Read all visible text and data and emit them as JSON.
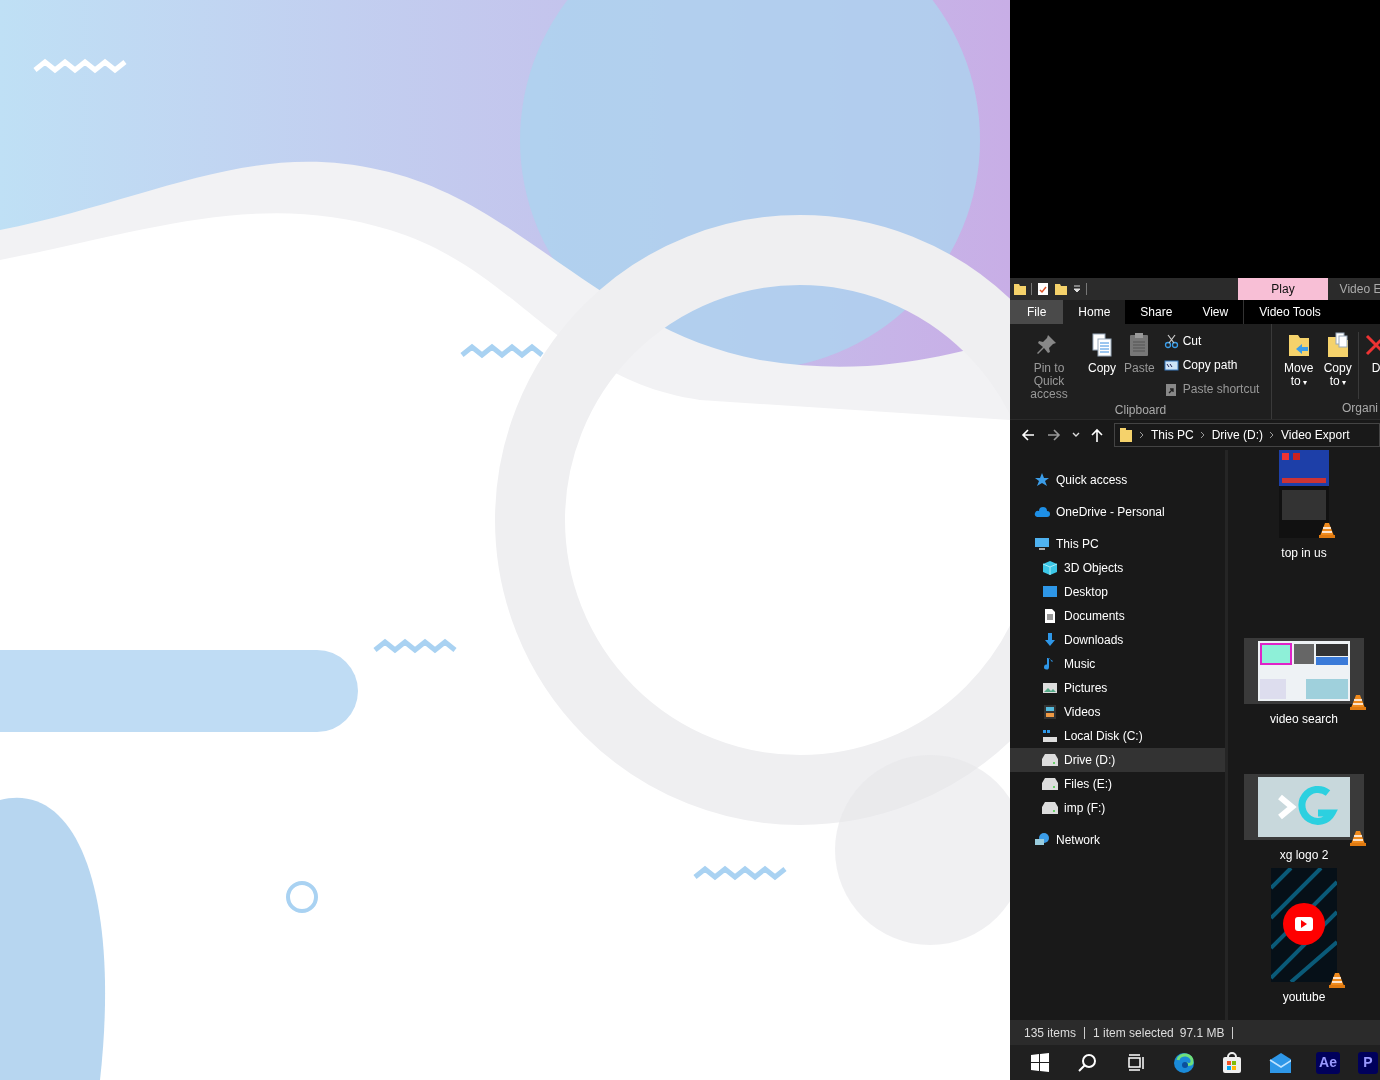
{
  "explorer": {
    "context_headers": [
      {
        "label": "Play",
        "highlighted": true
      },
      {
        "label": "Video E",
        "highlighted": false
      }
    ],
    "ribbon_tabs": [
      {
        "label": "File",
        "kind": "file",
        "selected": false
      },
      {
        "label": "Home",
        "kind": "tab",
        "selected": true
      },
      {
        "label": "Share",
        "kind": "tab",
        "selected": false
      },
      {
        "label": "View",
        "kind": "tab",
        "selected": false
      },
      {
        "label": "Video Tools",
        "kind": "tab",
        "selected": false
      }
    ],
    "ribbon_groups": [
      {
        "label": "Clipboard",
        "large_buttons": [
          {
            "label": "Pin to Quick access",
            "kind": "pin",
            "disabled": true
          },
          {
            "label": "Copy",
            "kind": "copy",
            "disabled": false
          },
          {
            "label": "Paste",
            "kind": "paste",
            "disabled": true
          }
        ],
        "small_buttons": [
          {
            "label": "Cut",
            "kind": "cut",
            "disabled": false
          },
          {
            "label": "Copy path",
            "kind": "path",
            "disabled": false
          },
          {
            "label": "Paste shortcut",
            "kind": "shortcut",
            "disabled": true
          }
        ]
      },
      {
        "label": "Organi",
        "large_buttons": [
          {
            "label": "Move to",
            "kind": "move",
            "disabled": false,
            "caret": "▾"
          },
          {
            "label": "Copy to",
            "kind": "copyto",
            "disabled": false,
            "caret": "▾"
          },
          {
            "label": "D",
            "kind": "delete",
            "disabled": false
          }
        ]
      }
    ],
    "address_crumbs": [
      "This PC",
      "Drive (D:)",
      "Video Export"
    ],
    "nav": [
      {
        "label": "Quick access",
        "kind": "star",
        "selected": false
      },
      {
        "label": "OneDrive - Personal",
        "kind": "cloud",
        "selected": false
      },
      {
        "label": "This PC",
        "kind": "pc",
        "selected": false,
        "children": [
          {
            "label": "3D Objects",
            "kind": "cube",
            "selected": false
          },
          {
            "label": "Desktop",
            "kind": "desktop",
            "selected": false
          },
          {
            "label": "Documents",
            "kind": "document",
            "selected": false
          },
          {
            "label": "Downloads",
            "kind": "download",
            "selected": false
          },
          {
            "label": "Music",
            "kind": "music",
            "selected": false
          },
          {
            "label": "Pictures",
            "kind": "pictures",
            "selected": false
          },
          {
            "label": "Videos",
            "kind": "videos",
            "selected": false
          },
          {
            "label": "Local Disk (C:)",
            "kind": "sysdisk",
            "selected": false
          },
          {
            "label": "Drive (D:)",
            "kind": "drive",
            "selected": true
          },
          {
            "label": "Files (E:)",
            "kind": "drive",
            "selected": false
          },
          {
            "label": "imp (F:)",
            "kind": "drive",
            "selected": false
          }
        ]
      },
      {
        "label": "Network",
        "kind": "network",
        "selected": false
      }
    ],
    "files": [
      {
        "name": "top in us",
        "kind": "portrait"
      },
      {
        "name": "video search",
        "kind": "film"
      },
      {
        "name": "xg logo 2",
        "kind": "film"
      },
      {
        "name": "youtube",
        "kind": "poster"
      }
    ],
    "status": {
      "count": "135 items",
      "selection": "1 item selected",
      "size": "97.1 MB"
    }
  },
  "taskbar": [
    {
      "kind": "start"
    },
    {
      "kind": "search"
    },
    {
      "kind": "taskview"
    },
    {
      "kind": "edge"
    },
    {
      "kind": "store"
    },
    {
      "kind": "mail"
    },
    {
      "kind": "app",
      "label": "Ae",
      "color": "#00005b"
    },
    {
      "kind": "app",
      "label": "P",
      "color": "#00005b"
    }
  ]
}
